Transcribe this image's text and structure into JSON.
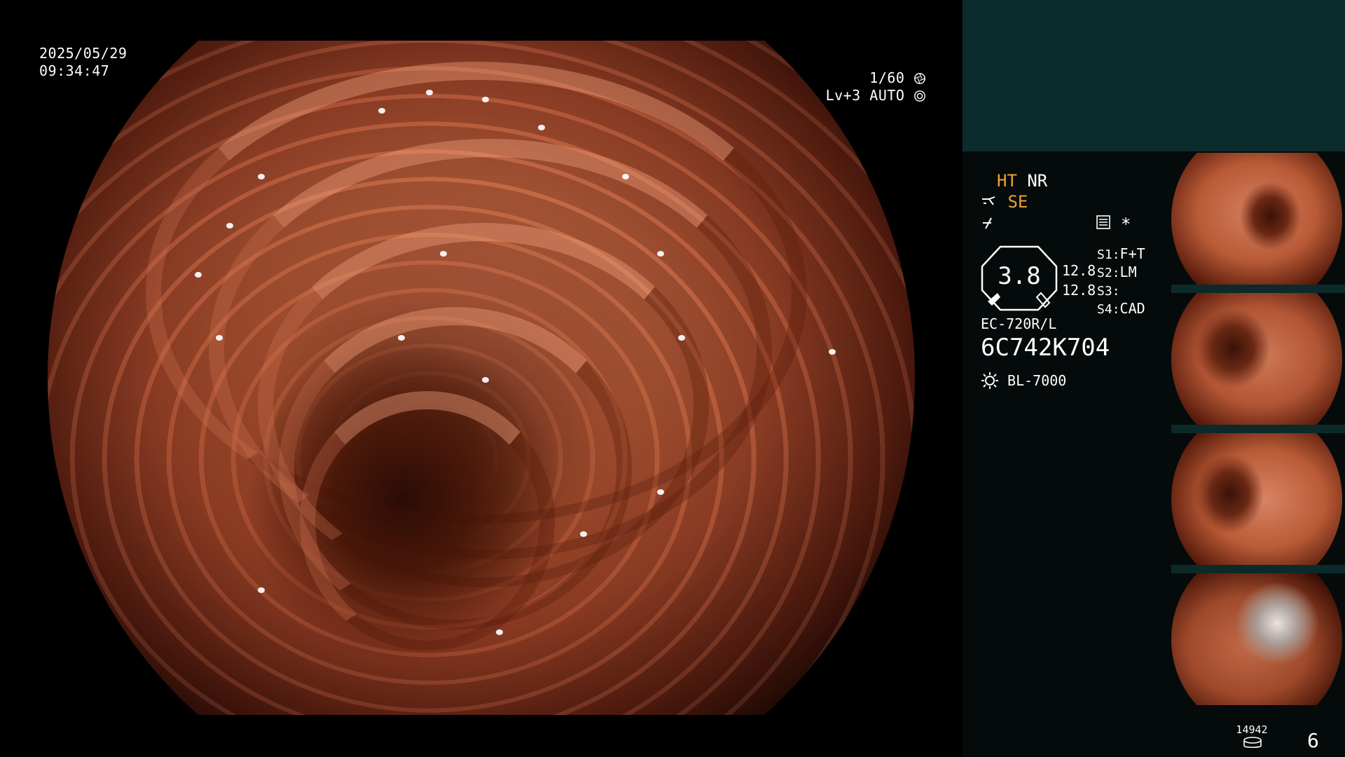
{
  "osd": {
    "date": "2025/05/29",
    "time": "09:34:47",
    "shutter": "1/60",
    "level": "Lv+3",
    "iris": "AUTO"
  },
  "panel": {
    "ht_label": "HT",
    "nr_label": "NR",
    "se_label": "SE",
    "zoom_value": "3.8",
    "zoom_values": [
      "12.8",
      "12.8"
    ],
    "switches": [
      {
        "key": "S1",
        "value": "F+T"
      },
      {
        "key": "S2",
        "value": "LM"
      },
      {
        "key": "S3",
        "value": ""
      },
      {
        "key": "S4",
        "value": "CAD"
      }
    ],
    "scope_model": "EC-720R/L",
    "scope_serial": "6C742K704",
    "light_source": "BL-7000",
    "record_count": "14942",
    "page_number": "6"
  },
  "colors": {
    "panel_bg": "#050b0b",
    "panel_header_bg": "#0c2b2c",
    "accent_orange": "#f0a030"
  },
  "icons": {
    "shutter": "shutter-aperture-icon",
    "iris": "iris-auto-icon",
    "scope_tip": "scope-tip-icon",
    "freeze": "freeze-icon",
    "menu": "menu-list-icon",
    "asterisk": "asterisk-icon",
    "light": "light-sun-icon",
    "storage": "storage-disk-icon"
  }
}
